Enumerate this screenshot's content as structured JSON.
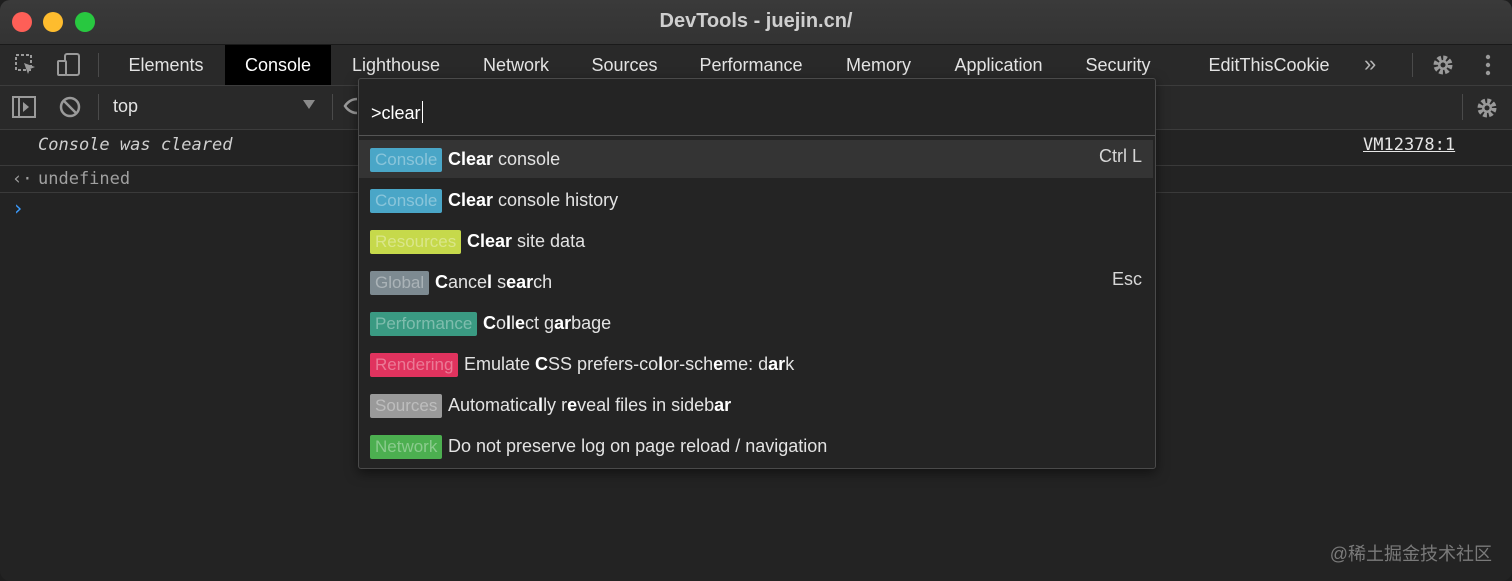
{
  "window": {
    "title": "DevTools - juejin.cn/"
  },
  "tabs": [
    {
      "label": "Elements"
    },
    {
      "label": "Console"
    },
    {
      "label": "Lighthouse"
    },
    {
      "label": "Network"
    },
    {
      "label": "Sources"
    },
    {
      "label": "Performance"
    },
    {
      "label": "Memory"
    },
    {
      "label": "Application"
    },
    {
      "label": "Security"
    },
    {
      "label": "EditThisCookie"
    }
  ],
  "active_tab": "Console",
  "toolbar": {
    "context": "top"
  },
  "console": {
    "cleared": "Console was cleared",
    "source_link": "VM12378:1",
    "result": "undefined"
  },
  "palette": {
    "query": ">clear",
    "items": [
      {
        "badge": "Console",
        "badge_color": "#4aa6c7",
        "label_html": "<b>Clear</b> console",
        "shortcut": "Ctrl L"
      },
      {
        "badge": "Console",
        "badge_color": "#4aa6c7",
        "label_html": "<b>Clear</b> console history",
        "shortcut": ""
      },
      {
        "badge": "Resources",
        "badge_color": "#c6d94b",
        "label_html": "<b>Clear</b> site data",
        "shortcut": ""
      },
      {
        "badge": "Global",
        "badge_color": "#7d8a91",
        "label_html": "<b>C</b>ance<b>l</b> s<b>e</b><b>ar</b>ch",
        "shortcut": "Esc"
      },
      {
        "badge": "Performance",
        "badge_color": "#3a9a82",
        "label_html": "<b>C</b>o<b>l</b>l<b>e</b>ct g<b>ar</b>bage",
        "shortcut": ""
      },
      {
        "badge": "Rendering",
        "badge_color": "#e0335e",
        "label_html": "Emulate <b>C</b>SS prefers-co<b>l</b>or-sch<b>e</b>me: d<b>ar</b>k",
        "shortcut": ""
      },
      {
        "badge": "Sources",
        "badge_color": "#9a9a9a",
        "label_html": "Automatica<b>l</b>ly r<b>e</b>veal files in sideb<b>ar</b>",
        "shortcut": ""
      },
      {
        "badge": "Network",
        "badge_color": "#4caf50",
        "label_html": "Do not preserve log on page reload / navigation",
        "shortcut": ""
      }
    ]
  },
  "watermark": "@稀土掘金技术社区",
  "colors": {
    "badge_text": "#e8e8e8"
  }
}
